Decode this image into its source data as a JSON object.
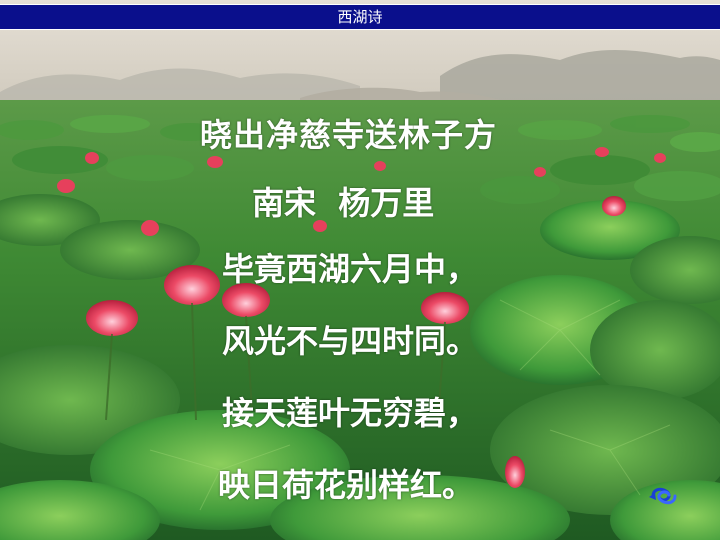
{
  "slide": {
    "title": "西湖诗"
  },
  "poem": {
    "title": "晓出净慈寺送林子方",
    "author": "南宋  杨万里",
    "lines": [
      "毕竟西湖六月中，",
      "风光不与四时同。",
      "接天莲叶无穷碧，",
      "映日荷花别样红。"
    ]
  },
  "background": {
    "description_icon": "lotus-pond-photo",
    "sky_color": "#d8d2c8",
    "leaf_color": "#3f8f33",
    "flower_color": "#e23a55"
  },
  "nav": {
    "icon": "return-arrow-icon",
    "color": "#1a3fd6"
  }
}
